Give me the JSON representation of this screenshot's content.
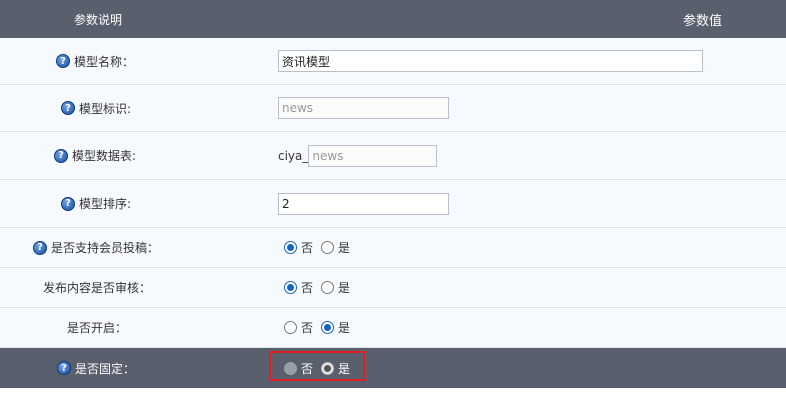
{
  "header": {
    "left": "参数说明",
    "right": "参数值"
  },
  "rows": {
    "model_name": {
      "label": "模型名称：",
      "value": "资讯模型"
    },
    "model_id": {
      "label": "模型标识:",
      "placeholder": "news"
    },
    "model_table": {
      "label": "模型数据表:",
      "prefix": "ciya_",
      "placeholder": "news"
    },
    "model_order": {
      "label": "模型排序:",
      "value": "2"
    },
    "member_submit": {
      "label": "是否支持会员投稿：",
      "opt_no": "否",
      "opt_yes": "是",
      "selected": "否"
    },
    "review": {
      "label": "发布内容是否审核：",
      "opt_no": "否",
      "opt_yes": "是",
      "selected": "否"
    },
    "enabled": {
      "label": "是否开启：",
      "opt_no": "否",
      "opt_yes": "是",
      "selected": "是"
    },
    "fixed": {
      "label": "是否固定：",
      "opt_no": "否",
      "opt_yes": "是",
      "selected": "是",
      "disabled": true
    }
  },
  "colors": {
    "header_bg": "#5a5f6d",
    "accent": "#1565c0",
    "highlight": "#e02020"
  }
}
